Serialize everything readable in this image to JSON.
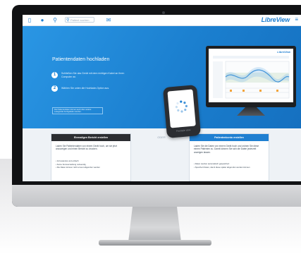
{
  "app": {
    "logo": "LibreView"
  },
  "topbar": {
    "search_placeholder": "Patient suchen",
    "icons": [
      "device-icon",
      "user-icon",
      "search-icon",
      "notification-icon",
      "menu-icon"
    ]
  },
  "hero": {
    "title": "Patientendaten hochladen",
    "steps": [
      {
        "num": "1",
        "text": "Schließen Sie das Gerät mit dem richtigen Kabel an Ihren Computer an."
      },
      {
        "num": "2",
        "text": "Wählen Sie unten die Hochlade-Option aus."
      }
    ],
    "note": "Die Patientendaten können auch über andere Lesegeräte hochgeladen werden."
  },
  "reader": {
    "brand": "FreeStyle Libre"
  },
  "mini_monitor": {
    "logo": "LibreView"
  },
  "cards": {
    "left": {
      "header": "Einmaligen Bericht erstellen",
      "body": "Laden Sie Patientendaten von einem Gerät hoch, um sie jetzt anzuzeigen und einen Bericht zu drucken.",
      "bullets": [
        "Ist kostenlos und einfach",
        "Keine Kontoerstellung notwendig",
        "Die Daten können nicht erneut abgerufen werden"
      ]
    },
    "separator": "ODER",
    "right": {
      "header": "Patientenkonto erstellen",
      "body": "Laden Sie die Daten von einem Gerät hoch und ordnen Sie diese einem Patienten zu. Damit können Sie sich die Daten jederzeit anzeigen lassen.",
      "bullets": [
        "Daten werden automatisch gespeichert",
        "Speichert Daten, damit diese später abgerufen werden können"
      ]
    }
  },
  "colors": {
    "accent": "#1f7fd1",
    "hero_blue": "#1b7fcf",
    "left_card_header": "#2b2d31",
    "right_card_header": "#1f7fd1"
  }
}
